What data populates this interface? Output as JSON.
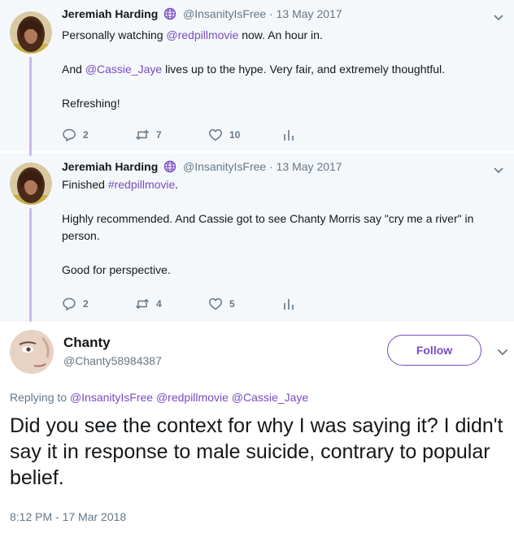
{
  "tweets": [
    {
      "name": "Jeremiah Harding",
      "handle": "@InsanityIsFree",
      "sep": "·",
      "date": "13 May 2017",
      "lines": [
        {
          "pre": "Personally watching ",
          "link": "@redpillmovie",
          "post": " now. An hour in."
        },
        {
          "pre": "And ",
          "link": "@Cassie_Jaye",
          "post": " lives up to the hype. Very fair, and extremely thoughtful."
        },
        {
          "pre": "Refreshing!",
          "link": "",
          "post": ""
        }
      ],
      "replies": "2",
      "retweets": "7",
      "likes": "10"
    },
    {
      "name": "Jeremiah Harding",
      "handle": "@InsanityIsFree",
      "sep": "·",
      "date": "13 May 2017",
      "lines": [
        {
          "pre": "Finished ",
          "link": "#redpillmovie",
          "post": "."
        },
        {
          "pre": "Highly recommended. And Cassie got to see Chanty Morris say \"cry me a river\" in person.",
          "link": "",
          "post": ""
        },
        {
          "pre": "Good for perspective.",
          "link": "",
          "post": ""
        }
      ],
      "replies": "2",
      "retweets": "4",
      "likes": "5"
    }
  ],
  "main": {
    "name": "Chanty",
    "handle": "@Chanty58984387",
    "follow_label": "Follow",
    "replying_prefix": "Replying to ",
    "replying_to": [
      "@InsanityIsFree",
      "@redpillmovie",
      "@Cassie_Jaye"
    ],
    "text": "Did you see the context for why I was saying it? I didn't say it in response to male suicide, contrary to popular belief.",
    "timestamp": "8:12 PM - 17 Mar 2018"
  },
  "colors": {
    "accent": "#794bc4",
    "thread_line": "#cab8ee",
    "muted": "#657786",
    "reply_bg": "#f5f8fa"
  },
  "icons": [
    "globe-icon",
    "chevron-down-icon",
    "reply-icon",
    "retweet-icon",
    "like-icon",
    "analytics-icon"
  ]
}
